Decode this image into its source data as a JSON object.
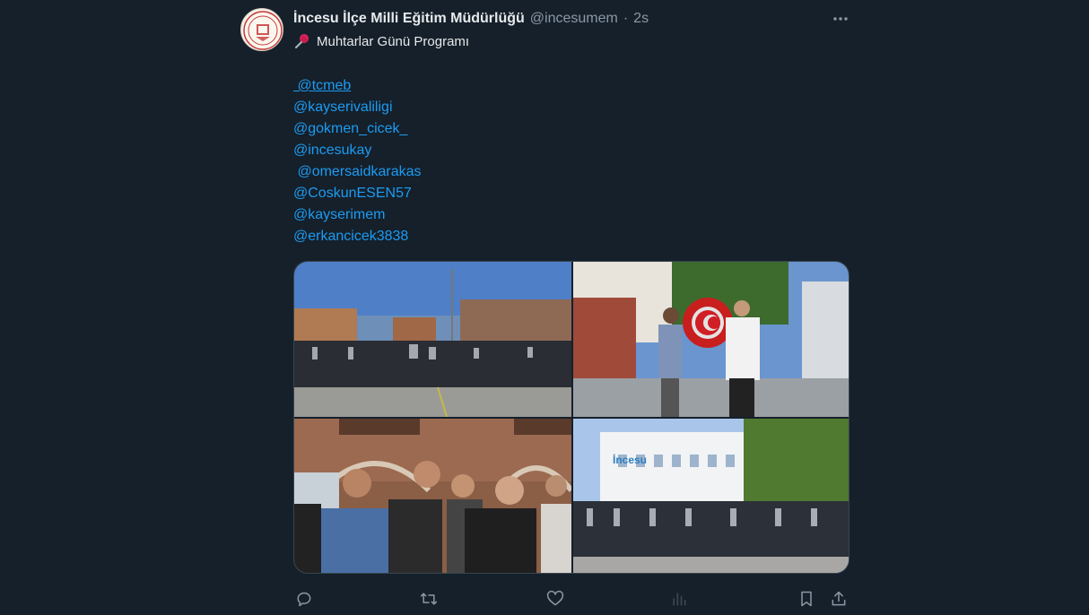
{
  "tweet": {
    "author_name": "İncesu İlçe Milli Eğitim Müdürlüğü",
    "handle": "@incesumem",
    "separator": "·",
    "time": "2s",
    "title_emoji_icon": "pushpin-icon",
    "title": "Muhtarlar Günü Programı",
    "mentions": [
      " @tcmeb",
      "@kayserivaliligi",
      "@gokmen_cicek_",
      "@incesukay",
      " @omersaidkarakas",
      "@CoskunESEN57",
      "@kayserimem",
      "@erkancicek3838"
    ],
    "photo4_sign": "İncesu"
  },
  "colors": {
    "background": "#15202b",
    "link": "#1d9bf0",
    "secondary_text": "#8b98a5"
  },
  "actions": [
    "reply-icon",
    "retweet-icon",
    "like-icon",
    "views-icon",
    "bookmark-icon",
    "share-icon"
  ]
}
